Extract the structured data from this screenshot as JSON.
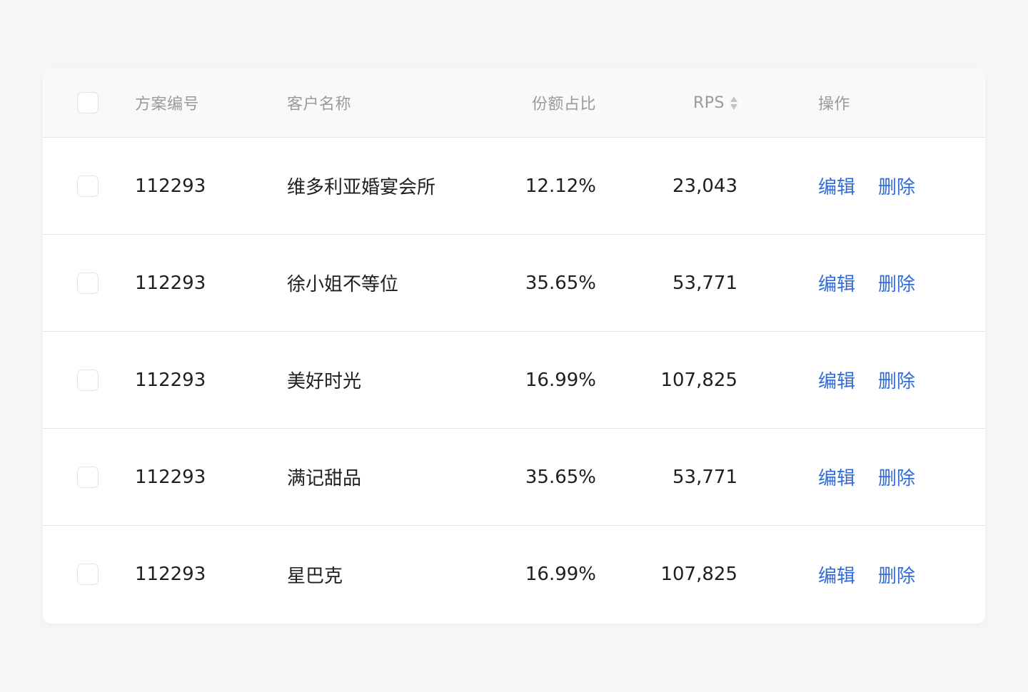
{
  "colors": {
    "page_bg": "#f6f6f6",
    "header_bg": "#f9f9f9",
    "header_text": "#9a9a9a",
    "body_text": "#1f1f1f",
    "link": "#2f6bdb",
    "border": "#e8e8e8"
  },
  "table": {
    "columns": {
      "code": "方案编号",
      "name": "客户名称",
      "share": "份额占比",
      "rps": "RPS",
      "ops": "操作"
    },
    "rps_sort_icon": "sort-icon",
    "rows": [
      {
        "code": "112293",
        "name": "维多利亚婚宴会所",
        "share": "12.12%",
        "rps": "23,043",
        "edit": "编辑",
        "delete": "删除"
      },
      {
        "code": "112293",
        "name": "徐小姐不等位",
        "share": "35.65%",
        "rps": "53,771",
        "edit": "编辑",
        "delete": "删除"
      },
      {
        "code": "112293",
        "name": "美好时光",
        "share": "16.99%",
        "rps": "107,825",
        "edit": "编辑",
        "delete": "删除"
      },
      {
        "code": "112293",
        "name": "满记甜品",
        "share": "35.65%",
        "rps": "53,771",
        "edit": "编辑",
        "delete": "删除"
      },
      {
        "code": "112293",
        "name": "星巴克",
        "share": "16.99%",
        "rps": "107,825",
        "edit": "编辑",
        "delete": "删除"
      }
    ]
  }
}
